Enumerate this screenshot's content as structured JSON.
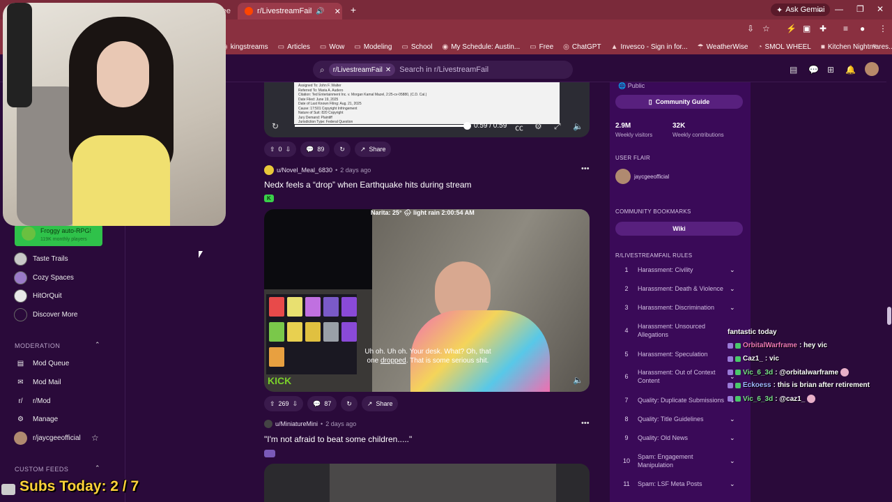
{
  "browser": {
    "tabs": [
      {
        "label": "Free",
        "active": false
      },
      {
        "label": "r/LivestreamFail",
        "active": true
      }
    ],
    "new_tab": "+",
    "gemini_label": "Ask Gemini",
    "bookmarks": [
      {
        "label": "kingstreams",
        "icon": "globe-icon"
      },
      {
        "label": "Articles",
        "icon": "folder-icon"
      },
      {
        "label": "Wow",
        "icon": "folder-icon"
      },
      {
        "label": "Modeling",
        "icon": "folder-icon"
      },
      {
        "label": "School",
        "icon": "folder-icon"
      },
      {
        "label": "My Schedule: Austin...",
        "icon": "globe-icon"
      },
      {
        "label": "Free",
        "icon": "folder-icon"
      },
      {
        "label": "ChatGPT",
        "icon": "chatgpt-icon"
      },
      {
        "label": "Invesco - Sign in for...",
        "icon": "invesco-icon"
      },
      {
        "label": "WeatherWise",
        "icon": "weather-icon"
      },
      {
        "label": "SMOL WHEEL",
        "icon": "wheel-icon"
      },
      {
        "label": "Kitchen Nightmares...",
        "icon": "video-icon"
      }
    ]
  },
  "header": {
    "community_chip": "r/LivestreamFail",
    "search_placeholder": "Search in r/LivestreamFail"
  },
  "overlay": {
    "subs_text": "Subs Today: 2 / 7"
  },
  "sidebar": {
    "game": {
      "title": "Froggy auto-RPG!",
      "subtitle": "119K monthly players"
    },
    "games": [
      {
        "label": "Taste Trails",
        "color": "#c8c8c8"
      },
      {
        "label": "Cozy Spaces",
        "color": "#9a7ac8"
      },
      {
        "label": "HitOrQuit",
        "color": "#e8e8e8"
      },
      {
        "label": "Discover More",
        "color": "#2a0a3a"
      }
    ],
    "moderation_heading": "MODERATION",
    "moderation": [
      {
        "label": "Mod Queue",
        "icon": "mod-queue-icon"
      },
      {
        "label": "Mod Mail",
        "icon": "mail-icon"
      },
      {
        "label": "r/Mod",
        "icon": "mod-icon"
      },
      {
        "label": "Manage",
        "icon": "manage-icon"
      },
      {
        "label": "r/jaycgeeofficial",
        "icon": "community-icon"
      }
    ],
    "custom_feeds_heading": "CUSTOM FEEDS"
  },
  "feed": {
    "video1": {
      "doc_lines": [
        "Assigned To: John F. Walter",
        "Referred To: Maria A. Audero",
        "Citation: Ted Entertainment Inc. v. Morgan Kamal Mazel, 2:25-cv-05880, (C.D. Cal.)",
        "Date Filed: June 19, 2025",
        "Date of Last Known Filing: Aug. 21, 2025",
        "Cause: 17:501 Copyright Infringement",
        "Nature of Suit: 820 Copyright",
        "Jury Demand: Plaintiff",
        "Jurisdiction Type: Federal Question"
      ],
      "time": "0:59 / 0:59",
      "progress": 1.0
    },
    "post1_actions": {
      "votes": "0",
      "comments": "89",
      "share": "Share"
    },
    "post2": {
      "user": "u/Novel_Meal_6830",
      "ago": "2 days ago",
      "title": "Nedx feels a “drop” when Earthquake hits during stream",
      "flair": "K",
      "overlay": "Narita: 25° 🌧 light rain 2:00:54 AM",
      "caption_pre": "Uh oh. Uh oh. Your desk. What? Oh, that one ",
      "caption_underlined": "dropped",
      "caption_post": ". That is some serious shit.",
      "logo": "KICK",
      "votes": "269",
      "comments": "87",
      "share": "Share"
    },
    "post3": {
      "user": "u/MiniatureMini",
      "ago": "2 days ago",
      "title": "\"I'm not afraid to beat some children.....\""
    }
  },
  "right": {
    "public": "Public",
    "community_guide": "Community Guide",
    "stats": [
      {
        "value": "2.9M",
        "label": "Weekly visitors"
      },
      {
        "value": "32K",
        "label": "Weekly contributions"
      }
    ],
    "user_flair_heading": "USER FLAIR",
    "user_flair_name": "jaycgeeofficial",
    "bookmarks_heading": "COMMUNITY BOOKMARKS",
    "wiki": "Wiki",
    "rules_heading": "R/LIVESTREAMFAIL RULES",
    "rules": [
      {
        "n": "1",
        "text": "Harassment: Civility"
      },
      {
        "n": "2",
        "text": "Harassment: Death & Violence"
      },
      {
        "n": "3",
        "text": "Harassment: Discrimination"
      },
      {
        "n": "4",
        "text": "Harassment: Unsourced Allegations"
      },
      {
        "n": "5",
        "text": "Harassment: Speculation"
      },
      {
        "n": "6",
        "text": "Harassment: Out of Context Content"
      },
      {
        "n": "7",
        "text": "Quality: Duplicate Submissions"
      },
      {
        "n": "8",
        "text": "Quality: Title Guidelines"
      },
      {
        "n": "9",
        "text": "Quality: Old News"
      },
      {
        "n": "10",
        "text": "Spam: Engagement Manipulation"
      },
      {
        "n": "11",
        "text": "Spam: LSF Meta Posts"
      }
    ]
  },
  "chat": {
    "top_text": "fantastic today",
    "messages": [
      {
        "user": "OrbitalWarframe",
        "color": "#f07ab8",
        "text": ": hey vic"
      },
      {
        "user": "Caz1_",
        "color": "#ffffff",
        "text": ":  vic"
      },
      {
        "user": "Vic_6_3d",
        "color": "#7ae08a",
        "text": ": @orbitalwarframe"
      },
      {
        "user": "Eckoess",
        "color": "#a0b8ff",
        "text": ": this is brian after retirement"
      },
      {
        "user": "Vic_6_3d",
        "color": "#7ae08a",
        "text": ": @caz1_"
      }
    ]
  }
}
